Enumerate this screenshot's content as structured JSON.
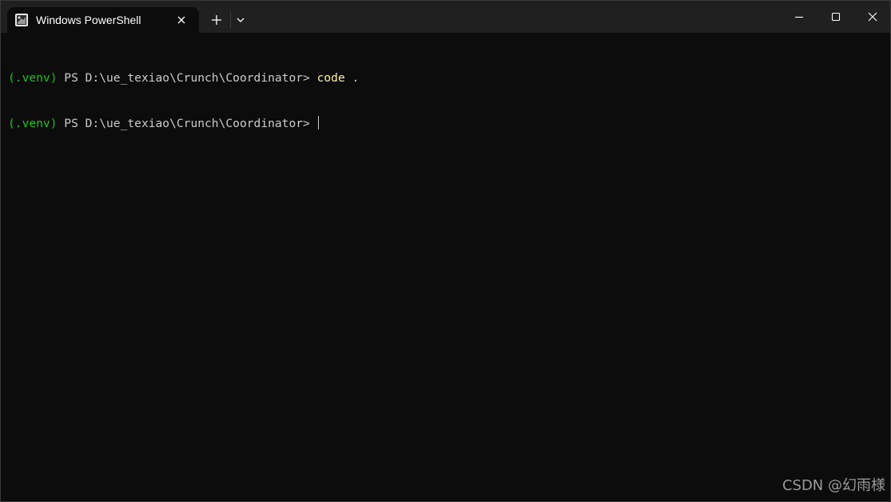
{
  "window": {
    "tab_title": "Windows PowerShell",
    "tab_icon": "powershell-icon",
    "new_tab_icon": "plus-icon",
    "dropdown_icon": "chevron-down-icon",
    "controls": [
      "minimize-icon",
      "maximize-icon",
      "close-icon"
    ]
  },
  "terminal": {
    "lines": [
      {
        "env": "(.venv)",
        "prompt": " PS D:\\ue_texiao\\Crunch\\Coordinator> ",
        "command": "code",
        "args": " ."
      },
      {
        "env": "(.venv)",
        "prompt": " PS D:\\ue_texiao\\Crunch\\Coordinator> ",
        "command": "",
        "args": ""
      }
    ]
  },
  "watermark": "CSDN @幻雨様",
  "colors": {
    "background": "#0c0c0c",
    "titlebar": "#202020",
    "env": "#16c60c",
    "command": "#f9f1a5",
    "text": "#cccccc"
  }
}
